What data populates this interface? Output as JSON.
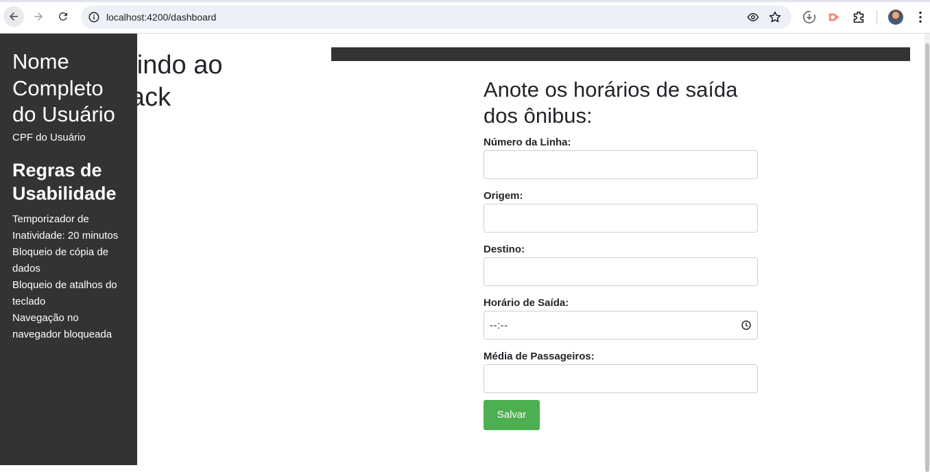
{
  "browser": {
    "url": "localhost:4200/dashboard"
  },
  "sidebar": {
    "user_name": "Nome Completo do Usuário",
    "user_cpf": "CPF do Usuário",
    "rules_title": "Regras de Usabilidade",
    "rules": [
      "Temporizador de Inatividade: 20 minutos",
      "Bloqueio de cópia de dados",
      "Bloqueio de atalhos do teclado",
      "Navegação no navegador bloqueada"
    ]
  },
  "main": {
    "welcome_title": "Bem-vindo ao BusTrack"
  },
  "form": {
    "title": "Anote os horários de saída dos ônibus:",
    "fields": {
      "line_number": {
        "label": "Número da Linha:",
        "value": ""
      },
      "origin": {
        "label": "Origem:",
        "value": ""
      },
      "destination": {
        "label": "Destino:",
        "value": ""
      },
      "departure_time": {
        "label": "Horário de Saída:",
        "placeholder": "--:--"
      },
      "avg_passengers": {
        "label": "Média de Passageiros:",
        "value": ""
      }
    },
    "save_label": "Salvar"
  },
  "colors": {
    "sidebar_bg": "#333333",
    "save_button": "#4caf50"
  }
}
